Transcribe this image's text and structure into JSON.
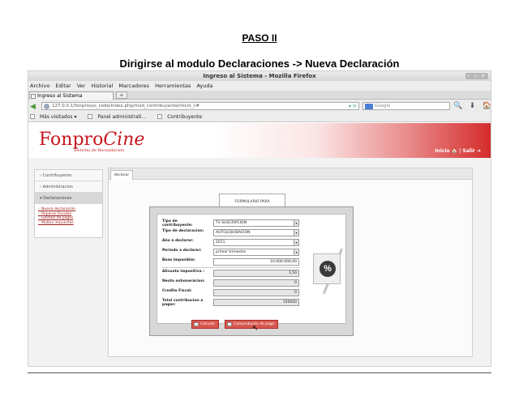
{
  "doc": {
    "step": "PASO II",
    "instruction": "Dirigirse al modulo Declaraciones -> Nueva Declaración"
  },
  "window": {
    "title": "Ingreso al Sistema - Mozilla Firefox",
    "controls": "– ▫ ×"
  },
  "menu": [
    "Archivo",
    "Editar",
    "Ver",
    "Historial",
    "Marcadores",
    "Herramientas",
    "Ayuda"
  ],
  "tab": {
    "label": "Ingreso al Sistema",
    "new_tab": "+"
  },
  "nav": {
    "url": "127.0.0.1/fonprosys_code/index.php/mod_contribuyente/inicio_c#",
    "search_placeholder": "Google",
    "icons": "🔍 ⬇ 🏠 ☰"
  },
  "bookmarks": [
    "Más visitados ▾",
    "Panel administrati...",
    "Contribuyente"
  ],
  "app": {
    "logo_main": "Fonpro",
    "logo_cine": "Cine",
    "slogan": "Sistema de Recaudación",
    "header_links": "Inicio 🏠 | Salir ➜"
  },
  "sidebar": {
    "items": [
      "Contribuyente",
      "Administracion",
      "Declaraciones"
    ],
    "links": [
      "Nueva declaración",
      "Reparos Fiscales",
      "Gestión de pagos",
      "Multas impuestas"
    ]
  },
  "content": {
    "tab": "declarar",
    "form_title": "FORMULARIO PARA DECLARACIONES"
  },
  "form": {
    "fields": [
      {
        "label": "Tipo de contribuyente:",
        "value": "TV SUSCRIPCION"
      },
      {
        "label": "Tipo de declaracion:",
        "value": "AUTOLIQUIDACION"
      },
      {
        "label": "Año a declarar:",
        "value": "2011"
      },
      {
        "label": "Periodo a declarar:",
        "value": "primer trimestre"
      },
      {
        "label": "Base imponible:",
        "value": "10.000.000,00"
      },
      {
        "label": "Alicuota impositiva :",
        "value": "1,50"
      },
      {
        "label": "Nexto exhonerácion:",
        "value": "0"
      },
      {
        "label": "Credito Fiscal:",
        "value": "0"
      },
      {
        "label": "Total contribucion a pagar:",
        "value": "150000"
      }
    ],
    "badge": "%",
    "btn_calc": "Calcular",
    "btn_pay": "Comprobante de pago"
  }
}
